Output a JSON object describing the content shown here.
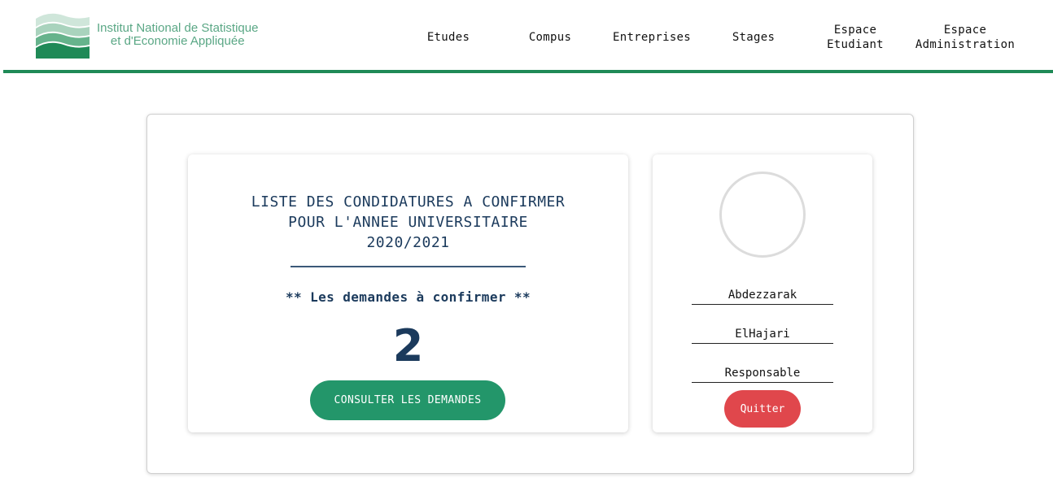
{
  "logo": {
    "line1": "Institut National de Statistique",
    "line2": "et d'Economie Appliquée"
  },
  "nav": {
    "etudes": "Etudes",
    "compus": "Compus",
    "entreprises": "Entreprises",
    "stages": "Stages",
    "espace_etudiant_1": "Espace",
    "espace_etudiant_2": "Etudiant",
    "espace_admin_1": "Espace",
    "espace_admin_2": "Administration"
  },
  "main": {
    "title_line1": "LISTE DES CONDIDATURES A CONFIRMER",
    "title_line2": "POUR L'ANNEE UNIVERSITAIRE",
    "title_line3": "2020/2021",
    "subtitle": "** Les demandes à confirmer **",
    "count": "2",
    "consult_button": "CONSULTER LES DEMANDES"
  },
  "profile": {
    "first_name": "Abdezzarak",
    "last_name": "ElHajari",
    "role": "Responsable",
    "quit_button": "Quitter"
  },
  "colors": {
    "brand_green": "#1f8a57",
    "button_green": "#23966a",
    "navy_text": "#1b3a5c",
    "quit_red": "#e0474c"
  }
}
